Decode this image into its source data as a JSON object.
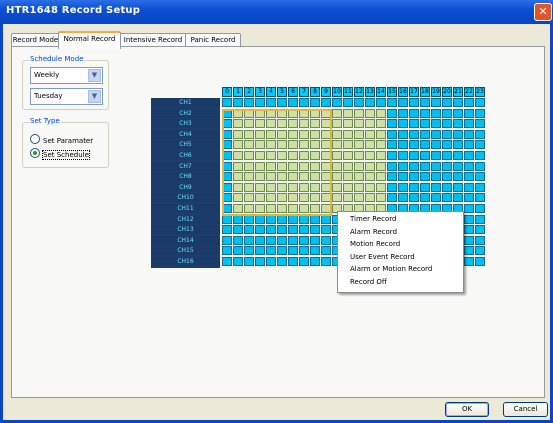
{
  "window": {
    "title": "HTR1648 Record Setup",
    "close_icon": "close-icon"
  },
  "tabs": [
    {
      "label": "Record Mode",
      "active": false
    },
    {
      "label": "Normal Record",
      "active": true
    },
    {
      "label": "Intensive Record",
      "active": false
    },
    {
      "label": "Panic Record",
      "active": false
    }
  ],
  "schedule_mode": {
    "label": "Schedule Mode",
    "period": "Weekly",
    "day": "Tuesday"
  },
  "set_type": {
    "label": "Set Type",
    "options": [
      {
        "label": "Set Paramater",
        "checked": false
      },
      {
        "label": "Set Schedule",
        "checked": true
      }
    ]
  },
  "schedule_grid": {
    "hours": [
      "0",
      "1",
      "2",
      "3",
      "4",
      "5",
      "6",
      "7",
      "8",
      "9",
      "10",
      "11",
      "12",
      "13",
      "14",
      "15",
      "16",
      "17",
      "18",
      "19",
      "20",
      "21",
      "22",
      "23"
    ],
    "channels": [
      "CH1",
      "CH2",
      "CH3",
      "CH4",
      "CH5",
      "CH6",
      "CH7",
      "CH8",
      "CH9",
      "CH10",
      "CH11",
      "CH12",
      "CH13",
      "CH14",
      "CH15",
      "CH16"
    ],
    "filled_channels": [
      "CH2",
      "CH11"
    ],
    "filled_hours": [
      "1",
      "14"
    ],
    "selection": {
      "channels": [
        "CH2",
        "CH11"
      ],
      "hours": [
        "0",
        "9"
      ]
    },
    "colors": {
      "empty": "#00c0f2",
      "filled": "#cfe0a4",
      "selection": "#e8b23c",
      "header": "#00ccff",
      "channel_band": "#1d3e6c"
    }
  },
  "context_menu": {
    "items": [
      "Timer Record",
      "Alarm Record",
      "Motion Record",
      "User Event Record",
      "Alarm or Motion Record",
      "Record Off"
    ]
  },
  "buttons": {
    "ok": "OK",
    "cancel": "Cancel"
  }
}
